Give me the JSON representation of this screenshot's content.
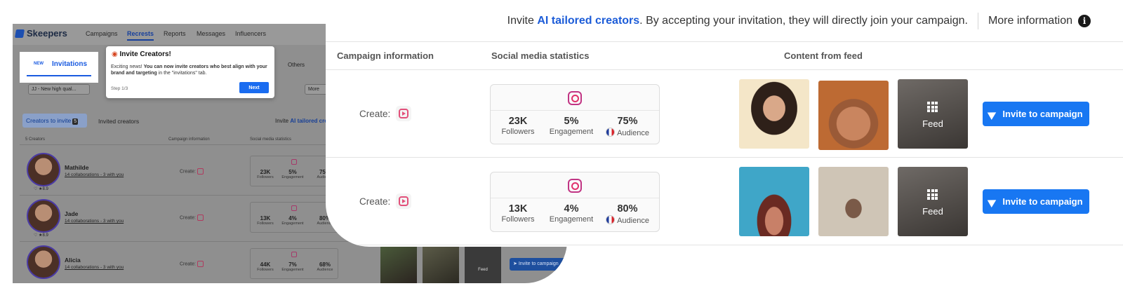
{
  "app": {
    "logo": "Skeepers",
    "nav": [
      "Campaigns",
      "Recrests",
      "Reports",
      "Messages",
      "Influencers"
    ],
    "invitations_badge": "NEW",
    "invitations_tab": "Invitations",
    "filters": {
      "campaign_select": "JJ - New high qual...",
      "others": "Others",
      "more": "More"
    },
    "tabs": {
      "to_invite": "Creators to invite",
      "to_invite_count": "5",
      "invited": "Invited creators"
    },
    "invite_hint_prefix": "Invite ",
    "invite_hint_highlight": "AI tailored cre",
    "table_headers": {
      "count": "5 Creators",
      "campaign": "Campaign information",
      "social": "Social media statistics"
    },
    "create_label": "Create:",
    "stat_labels": {
      "followers": "Followers",
      "engagement": "Engagement",
      "audience": "Audience"
    },
    "creators": [
      {
        "name": "Mathilde",
        "collab": "14 collaborations - 3 with you",
        "rating": "8.9",
        "followers": "23K",
        "engagement": "5%",
        "audience": "75%"
      },
      {
        "name": "Jade",
        "collab": "14 collaborations - 3 with you",
        "rating": "8.9",
        "followers": "13K",
        "engagement": "4%",
        "audience": "80%"
      },
      {
        "name": "Alicia",
        "collab": "14 collaborations - 3 with you",
        "rating": "",
        "followers": "44K",
        "engagement": "7%",
        "audience": "68%"
      }
    ],
    "feed_label": "Feed",
    "invite_button": "Invite to campaign"
  },
  "tooltip": {
    "title": "Invite Creators!",
    "body_prefix": "Exciting news! ",
    "body_bold": "You can now invite creators who best align with your brand and targeting",
    "body_suffix": " in the \"invitations\" tab.",
    "step": "Step 1/3",
    "next": "Next"
  },
  "zoom": {
    "banner_prefix": "Invite ",
    "banner_highlight": "AI tailored creators",
    "banner_suffix": ". By accepting your invitation, they will directly join your campaign.",
    "more_info": "More information",
    "headers": {
      "campaign": "Campaign information",
      "social": "Social media statistics",
      "content": "Content from feed"
    },
    "create_label": "Create:",
    "rows": [
      {
        "followers": "23K",
        "followers_label": "Followers",
        "engagement": "5%",
        "engagement_label": "Engagement",
        "audience": "75%",
        "audience_label": "Audience"
      },
      {
        "followers": "13K",
        "followers_label": "Followers",
        "engagement": "4%",
        "engagement_label": "Engagement",
        "audience": "80%",
        "audience_label": "Audience"
      }
    ],
    "feed_label": "Feed",
    "invite_button": "Invite to campaign"
  },
  "colors": {
    "accent": "#1877f2",
    "highlight": "#1c5cd8"
  }
}
